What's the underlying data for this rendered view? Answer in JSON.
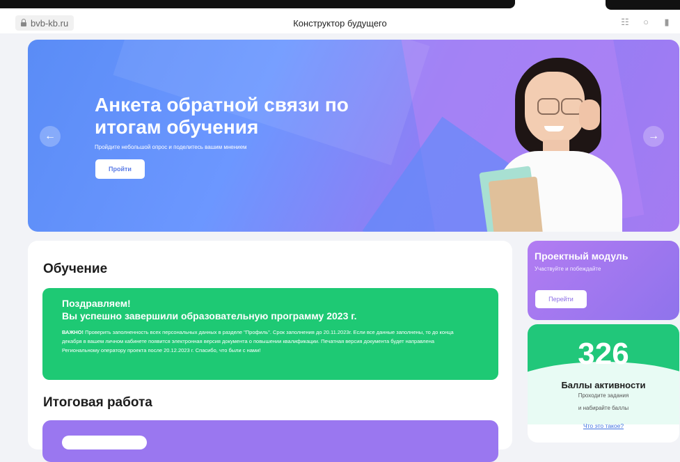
{
  "browser": {
    "url": "bvb-kb.ru",
    "title": "Конструктор будущего",
    "icons": [
      "reader-icon",
      "search-icon",
      "bookmark-icon"
    ]
  },
  "banner": {
    "title": "Анкета обратной связи по итогам обучения",
    "subtitle": "Пройдите небольшой опрос и поделитесь вашим мнением",
    "button": "Пройти",
    "prev_icon": "←",
    "next_icon": "→"
  },
  "main": {
    "section1_title": "Обучение",
    "notice": {
      "line1": "Поздравляем!",
      "line2": "Вы успешно завершили образовательную программу 2023 г.",
      "important": "ВАЖНО!",
      "text": " Проверить заполненность всех персональных данных в разделе \"Профиль\". Срок заполнения до 20.11.2023г. Если все данные заполнены, то до конца декабря в вашем личном кабинете появится электронная версия документа о повышении квалификации. Печатная версия документа будет направлена Региональному оператору проекта после 20.12.2023 г. Спасибо, что были с нами!"
    },
    "section2_title": "Итоговая работа"
  },
  "project": {
    "title": "Проектный модуль",
    "subtitle": "Участвуйте и побеждайте",
    "button": "Перейти"
  },
  "score": {
    "value": "326",
    "label": "Баллы активности",
    "line1": "Проходите задания",
    "line2": "и набирайте баллы",
    "link": "Что это такое?"
  },
  "colors": {
    "green": "#1ec974",
    "purple": "#9a77f0",
    "banner_blue": "#5a8cf6"
  }
}
